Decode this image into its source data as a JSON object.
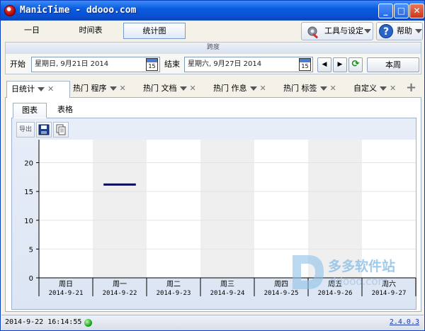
{
  "window": {
    "title": "ManicTime - ddooo.com",
    "minimize": "_",
    "maximize": "□",
    "close": "✕"
  },
  "toolbar": {
    "tabs": [
      {
        "label": "一日"
      },
      {
        "label": "时间表"
      },
      {
        "label": "统计图"
      }
    ],
    "tools_label": "工具与设定",
    "help_label": "帮助",
    "tools_icon": "tools-icon",
    "help_icon": "help-icon"
  },
  "span": {
    "header": "跨度",
    "start_label": "开始",
    "start_value": "星期日, 9月21日 2014",
    "end_label": "结束",
    "end_value": "星期六, 9月27日 2014",
    "calendar_day": "15",
    "this_week_label": "本周"
  },
  "subtabs": [
    {
      "label": "日统计"
    },
    {
      "label": "热门 程序"
    },
    {
      "label": "热门 文档"
    },
    {
      "label": "热门 作息"
    },
    {
      "label": "热门 标签"
    },
    {
      "label": "自定义"
    }
  ],
  "inner_tabs": [
    {
      "label": "图表"
    },
    {
      "label": "表格"
    }
  ],
  "chart_tools": {
    "export_label": "导出"
  },
  "chart_data": {
    "type": "bar",
    "categories": [
      "周日",
      "周一",
      "周二",
      "周三",
      "周四",
      "周五",
      "周六"
    ],
    "dates": [
      "2014-9-21",
      "2014-9-22",
      "2014-9-23",
      "2014-9-24",
      "2014-9-25",
      "2014-9-26",
      "2014-9-27"
    ],
    "shaded": [
      false,
      true,
      false,
      true,
      false,
      true,
      false
    ],
    "series": [
      {
        "values": [
          null,
          16.2,
          null,
          null,
          null,
          null,
          null
        ],
        "color": "#000080"
      }
    ],
    "yticks": [
      0,
      5,
      10,
      15,
      20
    ],
    "ylim": [
      0,
      24
    ],
    "grid": true
  },
  "watermark": {
    "main": "多多软件站",
    "sub": "ddooo.com"
  },
  "status": {
    "datetime": "2014-9-22 16:14:55",
    "version": "2.4.0.3"
  }
}
